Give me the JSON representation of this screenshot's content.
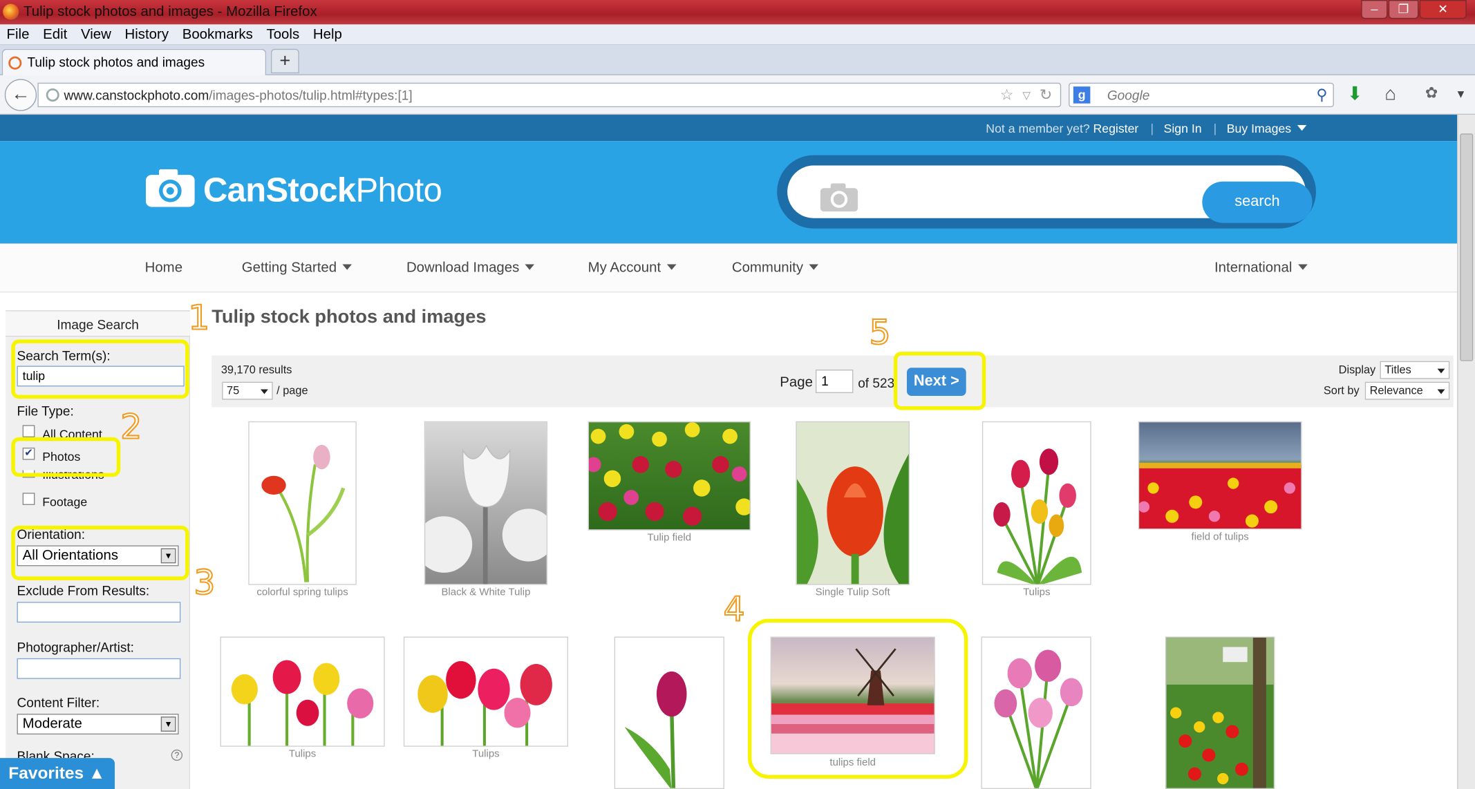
{
  "window": {
    "title": "Tulip stock photos and images - Mozilla Firefox",
    "controls": [
      "–",
      "❐",
      "✕"
    ]
  },
  "menubar": [
    "File",
    "Edit",
    "View",
    "History",
    "Bookmarks",
    "Tools",
    "Help"
  ],
  "tab": {
    "title": "Tulip stock photos and images",
    "new_tab": "+"
  },
  "address": {
    "host": "www.canstockphoto.com",
    "path": "/images-photos/tulip.html#types:[1]"
  },
  "search_engine": {
    "placeholder": "Google",
    "badge": "g"
  },
  "site": {
    "topbar": {
      "not_member": "Not a member yet?",
      "register": "Register",
      "sign_in": "Sign In",
      "buy": "Buy Images",
      "sep": "|"
    },
    "logo": {
      "bold": "CanStock",
      "light": "Photo"
    },
    "search_button": "search",
    "nav": [
      "Home",
      "Getting Started",
      "Download Images",
      "My Account",
      "Community",
      "International"
    ]
  },
  "sidebar": {
    "heading": "Image Search",
    "search_label": "Search Term(s):",
    "search_value": "tulip",
    "file_type_label": "File Type:",
    "file_types": [
      {
        "label": "All Content",
        "checked": false
      },
      {
        "label": "Photos",
        "checked": true
      },
      {
        "label": "Illustrations",
        "checked": false
      },
      {
        "label": "Footage",
        "checked": false
      }
    ],
    "orientation_label": "Orientation:",
    "orientation_value": "All Orientations",
    "exclude_label": "Exclude From Results:",
    "photographer_label": "Photographer/Artist:",
    "content_filter_label": "Content Filter:",
    "content_filter_value": "Moderate",
    "blank_space_label": "Blank Space:",
    "help": "?"
  },
  "favorites": "Favorites ▲",
  "content": {
    "title": "Tulip stock photos and images",
    "results": "39,170 results",
    "per_page_value": "75",
    "per_page_suffix": "/ page",
    "page_label": "Page",
    "page_value": "1",
    "of_pages": "of 523",
    "next": "Next >",
    "display_label": "Display",
    "display_value": "Titles",
    "sort_label": "Sort by",
    "sort_value": "Relevance"
  },
  "images_row1": [
    "colorful spring tulips",
    "Black & White Tulip",
    "Tulip field",
    "Single Tulip Soft",
    "Tulips",
    "field of tulips"
  ],
  "images_row2": [
    "Tulips",
    "Tulips",
    "",
    "tulips field",
    "",
    ""
  ],
  "annotations": [
    "1",
    "2",
    "3",
    "4",
    "5"
  ],
  "colors": {
    "header": "#2aa3e5",
    "topstrip": "#1f6fa8",
    "highlight": "#f6f400",
    "annotation": "#f29a1c",
    "next": "#3b8ed5"
  }
}
